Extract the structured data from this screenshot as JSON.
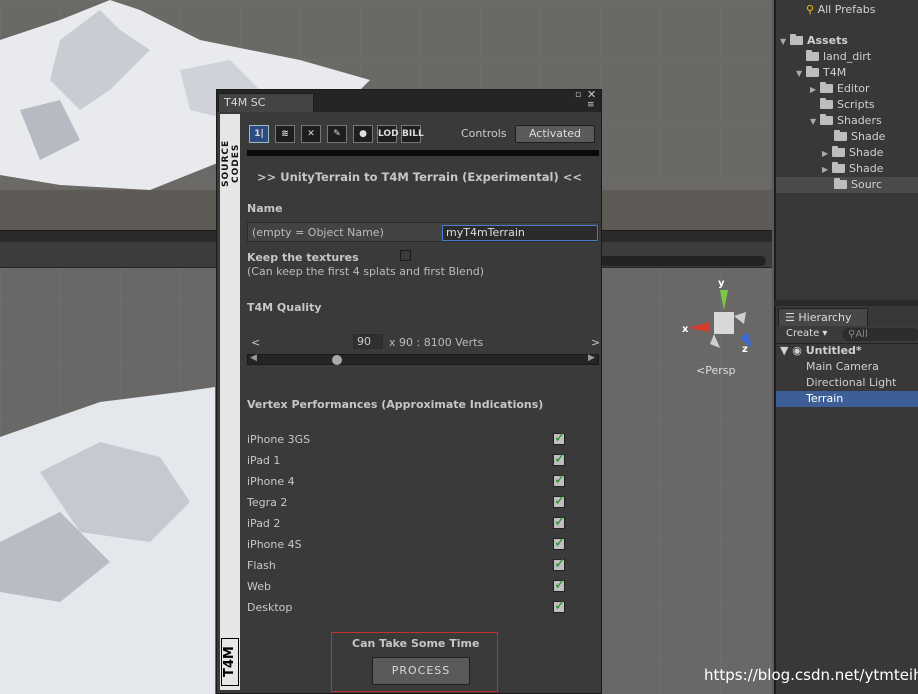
{
  "project": {
    "search_label": "All Prefabs",
    "tree": [
      "Assets",
      "land_dirt",
      "T4M",
      "Editor",
      "Scripts",
      "Shaders",
      "Shade",
      "Shade",
      "Shade",
      "Sourc"
    ]
  },
  "hierarchy": {
    "tab": "Hierarchy",
    "create": "Create",
    "search_placeholder": "All",
    "scene": "Untitled*",
    "items": [
      "Main Camera",
      "Directional Light",
      "Terrain"
    ]
  },
  "gizmo": {
    "y": "y",
    "x": "x",
    "z": "z",
    "persp": "Persp"
  },
  "dialog": {
    "tab": "T4M SC",
    "side_text": "SOURCE CODES",
    "side_logo": "T4M",
    "toolbar_icons": [
      "1|",
      "≋",
      "✕",
      "✎",
      "●",
      "LOD",
      "BILL"
    ],
    "controls_label": "Controls",
    "activated_label": "Activated",
    "heading": ">> UnityTerrain to T4M Terrain (Experimental) <<",
    "name_label": "Name",
    "name_hint": "(empty = Object Name)",
    "name_value": "myT4mTerrain",
    "keep_textures": "Keep the textures",
    "keep_textures_sub": "(Can keep the first 4 splats and first Blend)",
    "quality_label": "T4M Quality",
    "quality_left": "<",
    "quality_value": "90",
    "quality_verts": "x 90 : 8100 Verts",
    "quality_right": ">",
    "slider_value": 0.22,
    "perf_label": "Vertex Performances (Approximate Indications)",
    "devices": [
      "iPhone 3GS",
      "iPad 1",
      "iPhone 4",
      "Tegra 2",
      "iPad 2",
      "iPhone 4S",
      "Flash",
      "Web",
      "Desktop"
    ],
    "process_caption": "Can Take Some Time",
    "process_button": "PROCESS"
  },
  "watermark": "https://blog.csdn.net/ytmteihc"
}
